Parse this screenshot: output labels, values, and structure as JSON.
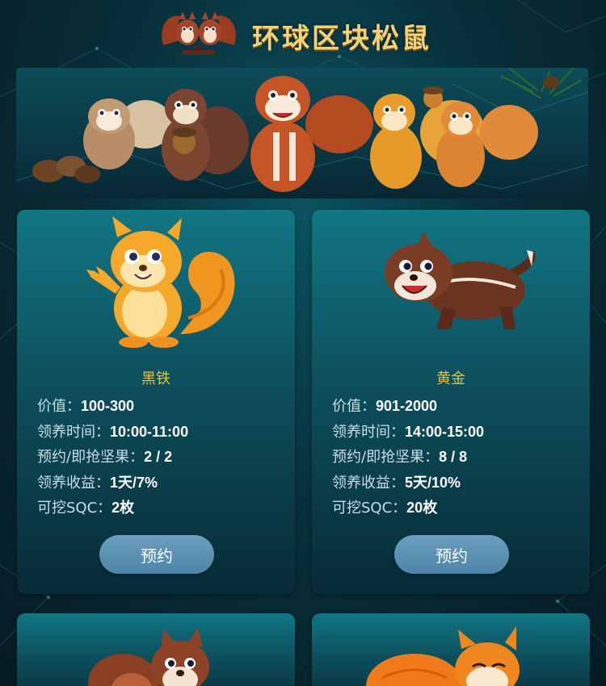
{
  "header": {
    "title": "环球区块松鼠"
  },
  "products": [
    {
      "name": "黑铁",
      "rows": [
        {
          "label": "价值：",
          "value": "100-300"
        },
        {
          "label": "领养时间：",
          "value": "10:00-11:00"
        },
        {
          "label": "预约/即抢坚果：",
          "value": "2 / 2"
        },
        {
          "label": "领养收益：",
          "value": "1天/7%"
        },
        {
          "label": "可挖SQC：",
          "value": "2枚"
        }
      ],
      "button": "预约"
    },
    {
      "name": "黄金",
      "rows": [
        {
          "label": "价值：",
          "value": "901-2000"
        },
        {
          "label": "领养时间：",
          "value": "14:00-15:00"
        },
        {
          "label": "预约/即抢坚果：",
          "value": "8 / 8"
        },
        {
          "label": "领养收益：",
          "value": "5天/10%"
        },
        {
          "label": "可挖SQC：",
          "value": "20枚"
        }
      ],
      "button": "预约"
    }
  ],
  "colors": {
    "accent_gold": "#e9c233",
    "button": "#5a8fb3",
    "card_top": "#127683",
    "card_bottom": "#072b36"
  },
  "icons": {
    "logo": "squirrel-pair-logo-icon",
    "banner": "squirrel-group-illustration",
    "card_images": [
      "orange-squirrel-icon",
      "brown-chipmunk-icon",
      "brown-squirrel-icon",
      "orange-squirrel-icon"
    ]
  }
}
